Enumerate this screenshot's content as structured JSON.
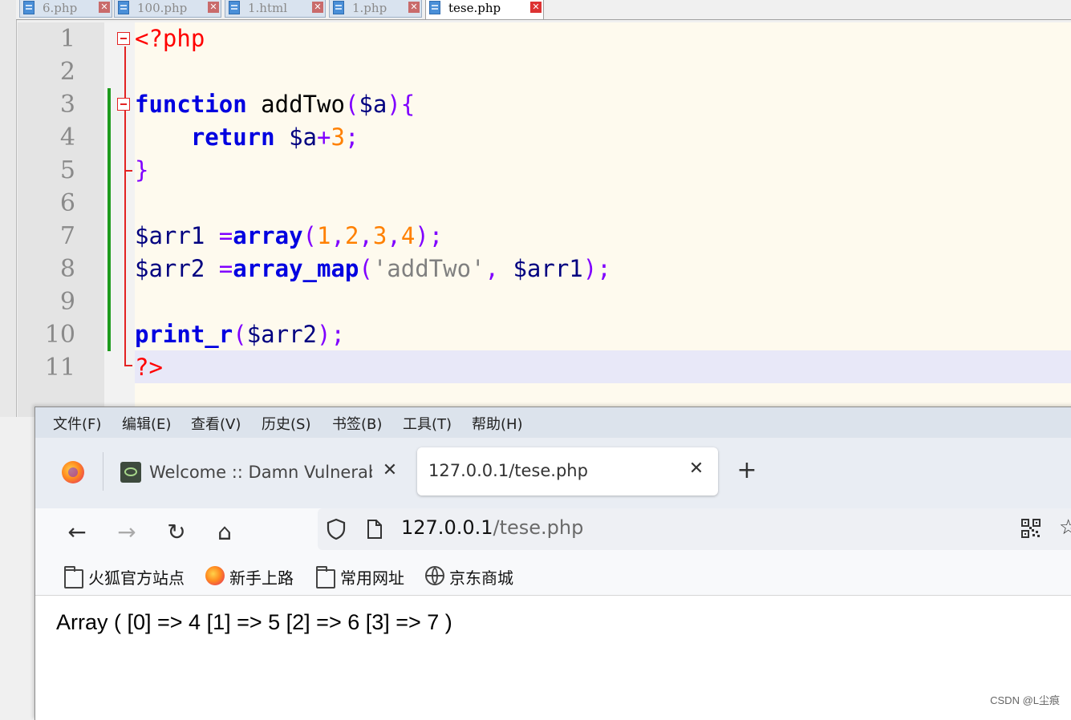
{
  "editor": {
    "tabs": [
      {
        "name": "6.php",
        "active": false
      },
      {
        "name": "100.php",
        "active": false
      },
      {
        "name": "1.html",
        "active": false
      },
      {
        "name": "1.php",
        "active": false
      },
      {
        "name": "tese.php",
        "active": true
      }
    ],
    "close_glyph": "✕",
    "line_numbers": [
      "1",
      "2",
      "3",
      "4",
      "5",
      "6",
      "7",
      "8",
      "9",
      "10",
      "11"
    ],
    "code": {
      "l1_open": "<?php",
      "l3_kw": "function",
      "l3_name": " addTwo",
      "l3_paren_open": "(",
      "l3_param": "$a",
      "l3_paren_close": "){",
      "l4_indent": "    ",
      "l4_kw": "return",
      "l4_sp": " ",
      "l4_var": "$a",
      "l4_op": "+",
      "l4_num": "3",
      "l4_semi": ";",
      "l5_close": "}",
      "l7_var": "$arr1",
      "l7_eq": " =",
      "l7_fn": "array",
      "l7_po": "(",
      "l7_n1": "1",
      "l7_c1": ",",
      "l7_n2": "2",
      "l7_c2": ",",
      "l7_n3": "3",
      "l7_c3": ",",
      "l7_n4": "4",
      "l7_end": ");",
      "l8_var": "$arr2",
      "l8_eq": " =",
      "l8_fn": "array_map",
      "l8_po": "(",
      "l8_str": "'addTwo'",
      "l8_comma": ", ",
      "l8_arg": "$arr1",
      "l8_end": ");",
      "l10_fn": "print_r",
      "l10_po": "(",
      "l10_arg": "$arr2",
      "l10_end": ");",
      "l11_close": "?>"
    }
  },
  "browser": {
    "menu": [
      "文件(F)",
      "编辑(E)",
      "查看(V)",
      "历史(S)",
      "书签(B)",
      "工具(T)",
      "帮助(H)"
    ],
    "tabs": [
      {
        "title": "Welcome :: Damn Vulnerable",
        "active": false
      },
      {
        "title": "127.0.0.1/tese.php",
        "active": true
      }
    ],
    "new_tab": "+",
    "tab_close": "✕",
    "nav": {
      "back": "←",
      "forward": "→",
      "reload": "↻",
      "home": "⌂"
    },
    "url": {
      "host": "127.0.0.1",
      "path": "/tese.php"
    },
    "star": "☆",
    "bookmarks": [
      {
        "label": "火狐官方站点",
        "icon": "folder-icon"
      },
      {
        "label": "新手上路",
        "icon": "firefox-icon"
      },
      {
        "label": "常用网址",
        "icon": "folder-icon"
      },
      {
        "label": "京东商城",
        "icon": "globe-icon"
      }
    ],
    "page_output": "Array ( [0] => 4 [1] => 5 [2] => 6 [3] => 7 )"
  },
  "watermark": "CSDN @L尘痕",
  "colors": {
    "keyword": "#0000e0",
    "operator": "#8000ff",
    "number": "#ff8000",
    "string": "#808080",
    "php_tag": "#ff0000",
    "change_bar": "#1e9b1e"
  }
}
